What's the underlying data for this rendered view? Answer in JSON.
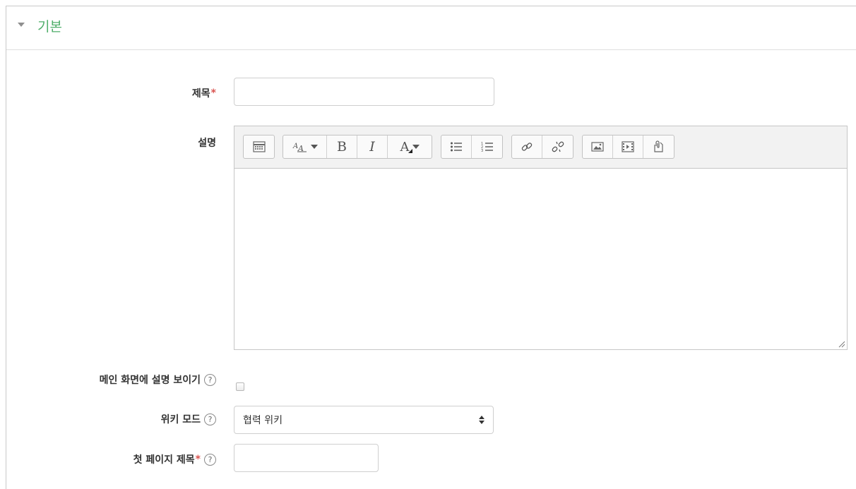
{
  "section": {
    "title": "기본"
  },
  "form": {
    "name_label": "제목",
    "description_label": "설명",
    "show_description_label": "메인 화면에 설명 보이기",
    "wiki_mode_label": "위키 모드",
    "wiki_mode_value": "협력 위키",
    "first_page_label": "첫 페이지 제목",
    "required_mark": "*",
    "help_glyph": "?"
  },
  "editor": {
    "toolbar": [
      {
        "group": "toggle",
        "buttons": [
          "toolbar-toggle-icon"
        ]
      },
      {
        "group": "text",
        "buttons": [
          "font-style-icon",
          "bold-icon",
          "italic-icon",
          "font-color-icon"
        ]
      },
      {
        "group": "lists",
        "buttons": [
          "bullet-list-icon",
          "numbered-list-icon"
        ]
      },
      {
        "group": "links",
        "buttons": [
          "link-icon",
          "unlink-icon"
        ]
      },
      {
        "group": "media",
        "buttons": [
          "image-icon",
          "media-icon",
          "file-icon"
        ]
      }
    ],
    "bold_glyph": "B",
    "italic_glyph": "I",
    "font_glyph": "A"
  },
  "colors": {
    "section_title": "#4fae6a",
    "required": "#d9534f",
    "border": "#c9c9c9"
  }
}
